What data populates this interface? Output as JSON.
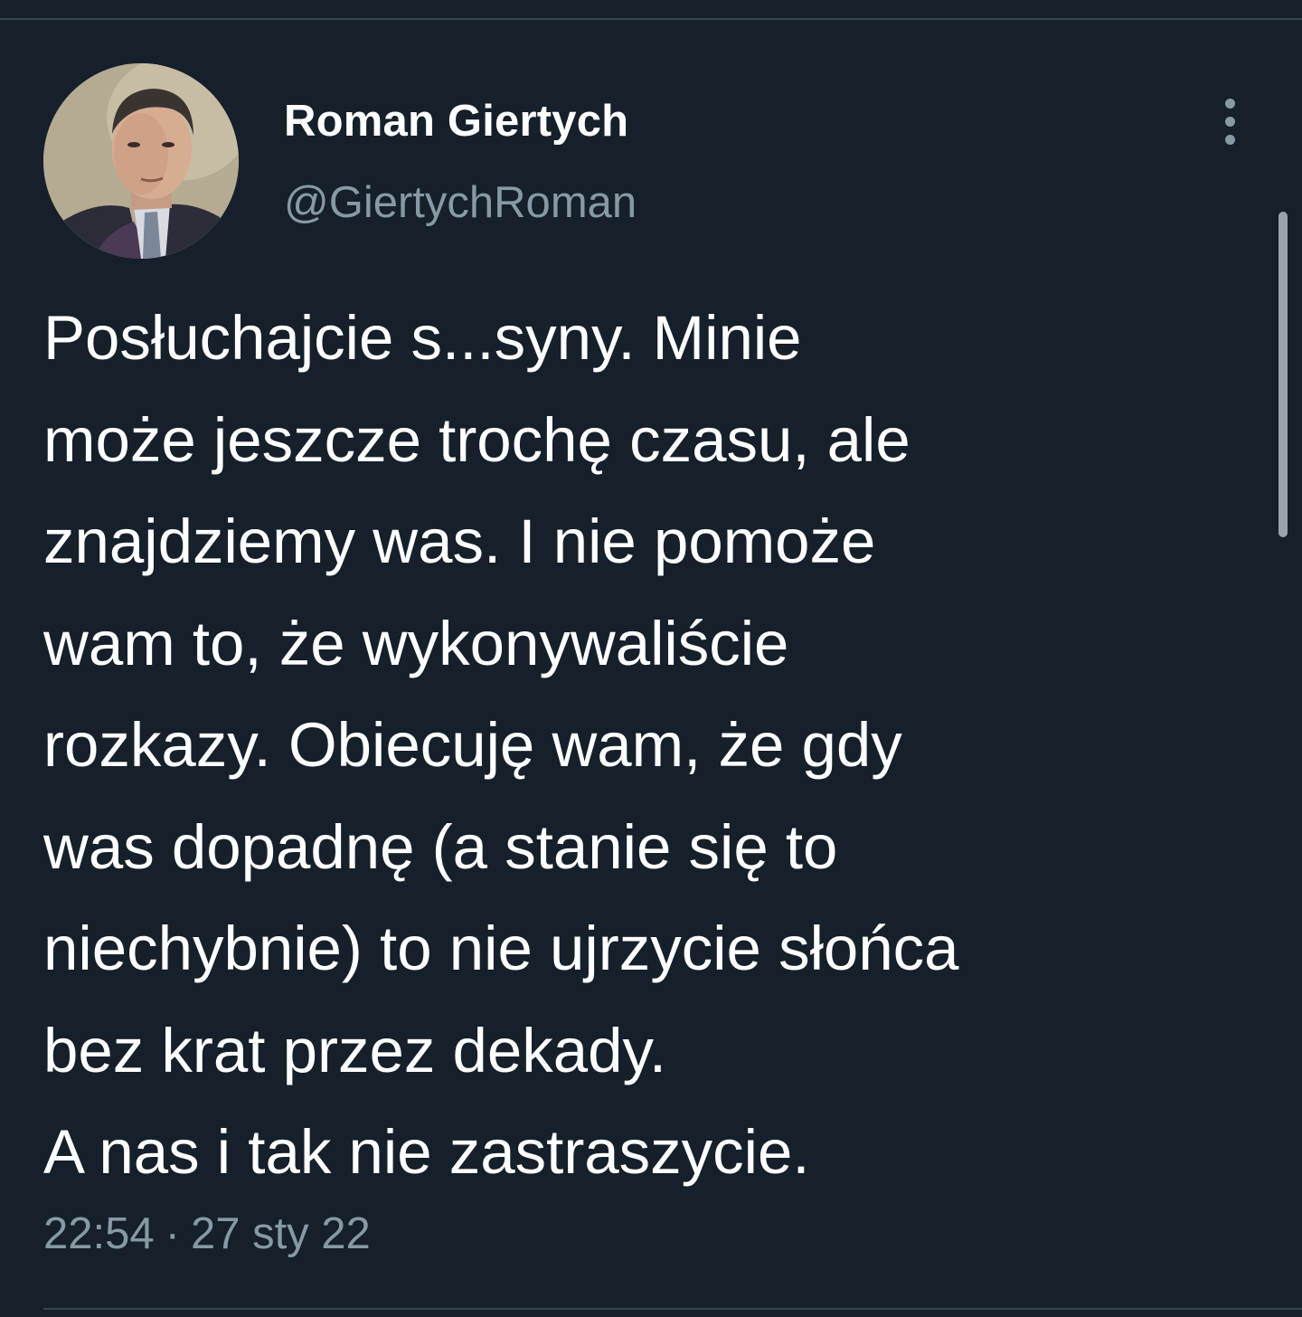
{
  "tweet": {
    "author": {
      "display_name": "Roman Giertych",
      "handle": "@GiertychRoman",
      "avatar_icon": "person-portrait-avatar"
    },
    "text_lines": [
      "Posłuchajcie s...syny. Minie",
      "może jeszcze trochę czasu, ale",
      "znajdziemy was. I nie pomoże",
      "wam to, że wykonywaliście",
      "rozkazy. Obiecuję wam, że gdy",
      "was dopadnę (a stanie się to",
      "niechybnie) to nie ujrzycie słońca",
      "bez krat przez dekady.",
      "A nas i tak nie zastraszycie."
    ],
    "time": "22:54",
    "separator": "·",
    "date": "27 sty 22"
  },
  "icons": {
    "more": "vertical-ellipsis-icon"
  },
  "colors": {
    "background": "#15202b",
    "text": "#ffffff",
    "secondary_text": "#8899a6",
    "divider": "#38444d"
  }
}
